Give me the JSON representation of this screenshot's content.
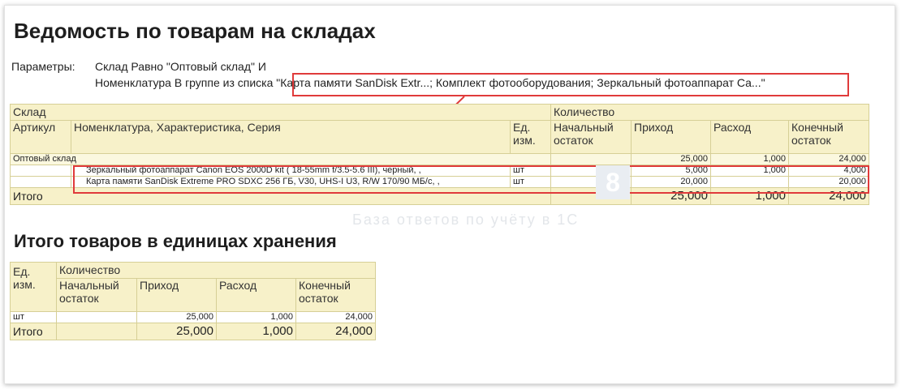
{
  "report": {
    "title": "Ведомость по товарам на складах",
    "params_label": "Параметры:",
    "param_line1": "Склад Равно \"Оптовый склад\" И",
    "param_line2_prefix": "Номенклатура В группе из списка ",
    "param_line2_value": "\"Карта памяти SanDisk Extr...; Комплект фотооборудования; Зеркальный фотоаппарат Са...\""
  },
  "main_table": {
    "header": {
      "sklad": "Склад",
      "kolichestvo": "Количество",
      "artikul": "Артикул",
      "nomenklatura": "Номенклатура, Характеристика, Серия",
      "ed_izm": "Ед. изм.",
      "nach_ostatok": "Начальный остаток",
      "prihod": "Приход",
      "rashod": "Расход",
      "kon_ostatok": "Конечный остаток"
    },
    "group_row": {
      "name": "Оптовый склад",
      "nach": "",
      "prihod": "25,000",
      "rashod": "1,000",
      "kon": "24,000"
    },
    "rows": [
      {
        "artikul": "",
        "name": "Зеркальный фотоаппарат Canon EOS 2000D kit ( 18-55mm f/3.5-5.6 III), черный, ,",
        "unit": "шт",
        "nach": "",
        "prihod": "5,000",
        "rashod": "1,000",
        "kon": "4,000"
      },
      {
        "artikul": "",
        "name": "Карта памяти SanDisk Extreme PRO SDXC 256 ГБ, V30, UHS-I U3, R/W 170/90 МБ/с, ,",
        "unit": "шт",
        "nach": "",
        "prihod": "20,000",
        "rashod": "",
        "kon": "20,000"
      }
    ],
    "total": {
      "label": "Итого",
      "nach": "",
      "prihod": "25,000",
      "rashod": "1,000",
      "kon": "24,000"
    }
  },
  "units_section": {
    "title": "Итого товаров в единицах хранения",
    "header": {
      "ed_izm": "Ед. изм.",
      "kolichestvo": "Количество",
      "nach_ostatok": "Начальный остаток",
      "prihod": "Приход",
      "rashod": "Расход",
      "kon_ostatok": "Конечный остаток"
    },
    "row": {
      "unit": "шт",
      "nach": "",
      "prihod": "25,000",
      "rashod": "1,000",
      "kon": "24,000"
    },
    "total": {
      "label": "Итого",
      "nach": "",
      "prihod": "25,000",
      "rashod": "1,000",
      "kon": "24,000"
    }
  },
  "watermark": {
    "text": "База ответов по учёту в 1С",
    "logo": "8"
  },
  "colors": {
    "header_bg": "#f7f1c9",
    "grid_border": "#d6cf96",
    "highlight": "#e03b3b"
  }
}
